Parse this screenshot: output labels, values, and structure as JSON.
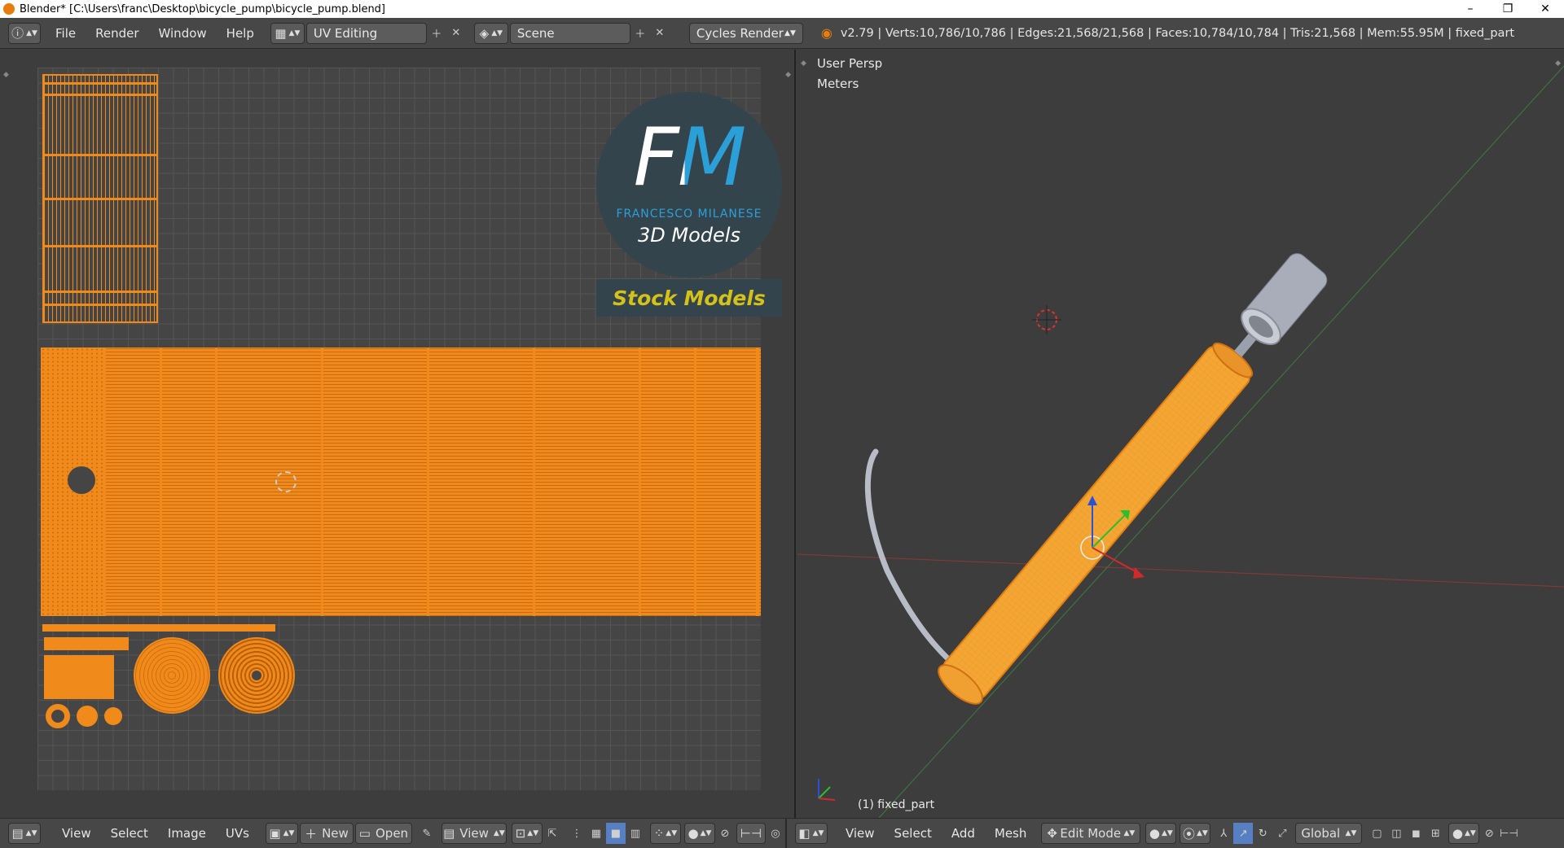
{
  "window": {
    "title": "Blender* [C:\\Users\\franc\\Desktop\\bicycle_pump\\bicycle_pump.blend]",
    "minimize": "–",
    "restore": "❐",
    "close": "✕"
  },
  "info_header": {
    "menus": [
      "File",
      "Render",
      "Window",
      "Help"
    ],
    "screen_layout": "UV Editing",
    "scene": "Scene",
    "render_engine": "Cycles Render",
    "stats": "v2.79 | Verts:10,786/10,786 | Edges:21,568/21,568 | Faces:10,784/10,784 | Tris:21,568 | Mem:55.95M | fixed_part"
  },
  "uv_editor": {
    "logo": {
      "letters": "FM",
      "brand": "FRANCESCO MILANESE",
      "tagline": "3D Models",
      "banner": "Stock Models"
    },
    "header": {
      "menus": [
        "View",
        "Select",
        "Image",
        "UVs"
      ],
      "new_label": "New",
      "open_label": "Open",
      "view_label": "View"
    }
  },
  "viewport": {
    "view_name": "User Persp",
    "units": "Meters",
    "object_label": "(1) fixed_part",
    "header": {
      "menus": [
        "View",
        "Select",
        "Add",
        "Mesh"
      ],
      "mode": "Edit Mode",
      "orientation": "Global"
    }
  },
  "colors": {
    "accent_orange": "#f08a1b",
    "logo_blue": "#2ba0d8",
    "banner_yellow": "#d4c21a"
  }
}
